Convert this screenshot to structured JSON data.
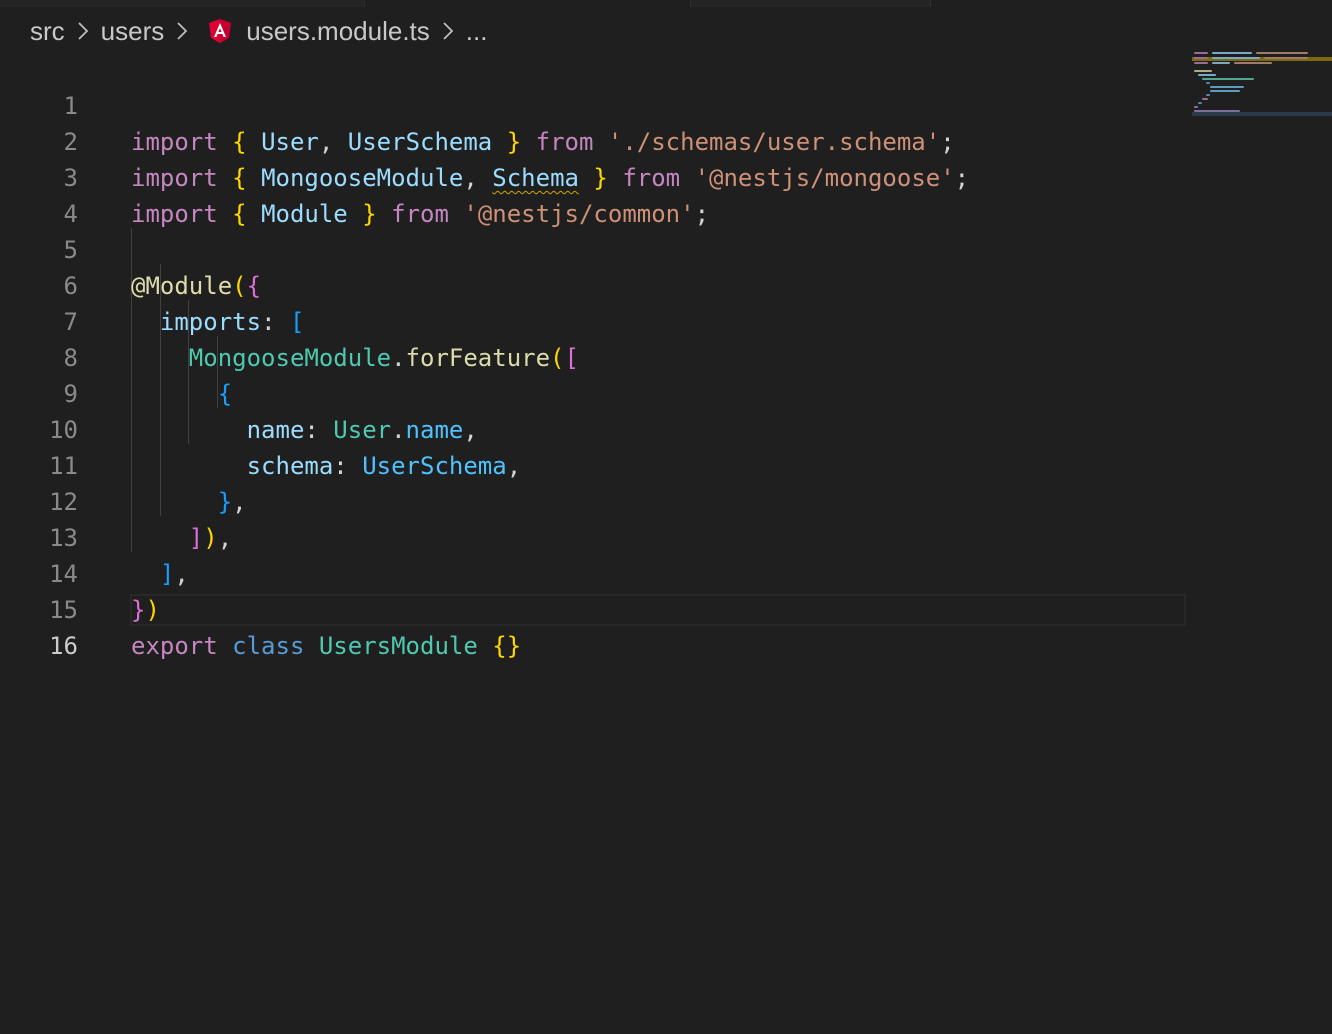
{
  "breadcrumb": {
    "items": [
      "src",
      "users",
      "users.module.ts",
      "..."
    ],
    "file_icon": "angular-icon"
  },
  "editor": {
    "active_line": 16,
    "line_numbers": [
      "1",
      "2",
      "3",
      "4",
      "5",
      "6",
      "7",
      "8",
      "9",
      "10",
      "11",
      "12",
      "13",
      "14",
      "15",
      "16"
    ],
    "tokens": {
      "l1": [
        "import",
        "{",
        "User",
        ",",
        "UserSchema",
        "}",
        "from",
        "'./schemas/user.schema'",
        ";"
      ],
      "l2": [
        "import",
        "{",
        "MongooseModule",
        ",",
        "Schema",
        "}",
        "from",
        "'@nestjs/mongoose'",
        ";"
      ],
      "l3": [
        "import",
        "{",
        "Module",
        "}",
        "from",
        "'@nestjs/common'",
        ";"
      ],
      "l5": [
        "@Module",
        "(",
        "{"
      ],
      "l6": [
        "imports",
        ":",
        "["
      ],
      "l7": [
        "MongooseModule",
        ".",
        "forFeature",
        "(",
        "["
      ],
      "l8": [
        "{"
      ],
      "l9": [
        "name",
        ":",
        "User",
        ".",
        "name",
        ","
      ],
      "l10": [
        "schema",
        ":",
        "UserSchema",
        ","
      ],
      "l11": [
        "}",
        ","
      ],
      "l12": [
        "]",
        ")",
        ","
      ],
      "l13": [
        "]",
        ","
      ],
      "l14": [
        "}",
        ")"
      ],
      "l15": [
        "export",
        "class",
        "UsersModule",
        "{}"
      ]
    }
  },
  "colors": {
    "background": "#1f1f1f",
    "keyword": "#c586c0",
    "string": "#ce9178",
    "type": "#4ec9b0",
    "variable": "#9cdcfe",
    "warning_squiggle": "#cca700",
    "angular_red": "#dd0031"
  }
}
